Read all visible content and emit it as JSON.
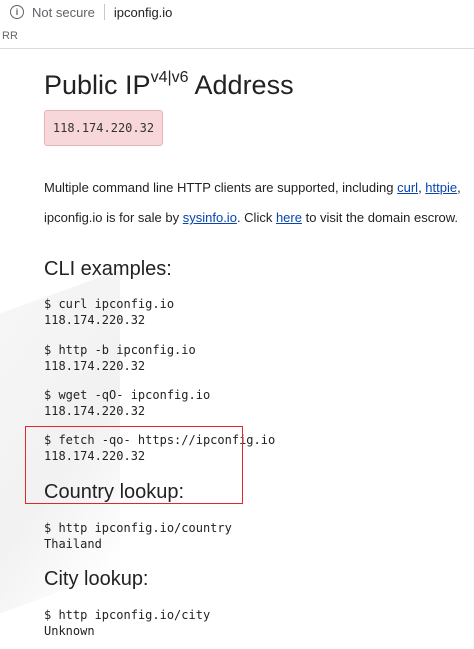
{
  "browser": {
    "security_label": "Not secure",
    "url": "ipconfig.io",
    "bookmark_text": "RR"
  },
  "page": {
    "title_main": "Public IP",
    "title_sup": "v4|v6",
    "title_end": " Address",
    "ip": "118.174.220.32",
    "clients_text": "Multiple command line HTTP clients are supported, including ",
    "clients_links": [
      "curl",
      "httpie"
    ],
    "clients_sep": ", ",
    "clients_tail": ",",
    "sale_text_1": "ipconfig.io is for sale by ",
    "sale_link": "sysinfo.io",
    "sale_text_2": ". Click ",
    "here_link": "here",
    "sale_text_3": " to visit the domain escrow.",
    "cli_heading": "CLI examples:",
    "cli_examples": [
      {
        "cmd": "$ curl ipconfig.io",
        "out": "118.174.220.32"
      },
      {
        "cmd": "$ http -b ipconfig.io",
        "out": "118.174.220.32"
      },
      {
        "cmd": "$ wget -qO- ipconfig.io",
        "out": "118.174.220.32"
      },
      {
        "cmd": "$ fetch -qo- https://ipconfig.io",
        "out": "118.174.220.32"
      }
    ],
    "country_heading": "Country lookup:",
    "country_cmd": "$ http ipconfig.io/country",
    "country_out": "Thailand",
    "city_heading": "City lookup:",
    "city_cmd": "$ http ipconfig.io/city",
    "city_out": "Unknown"
  },
  "colors": {
    "link": "#0645ad",
    "ip_bg": "#f8d7da",
    "highlight": "#e0262f"
  }
}
